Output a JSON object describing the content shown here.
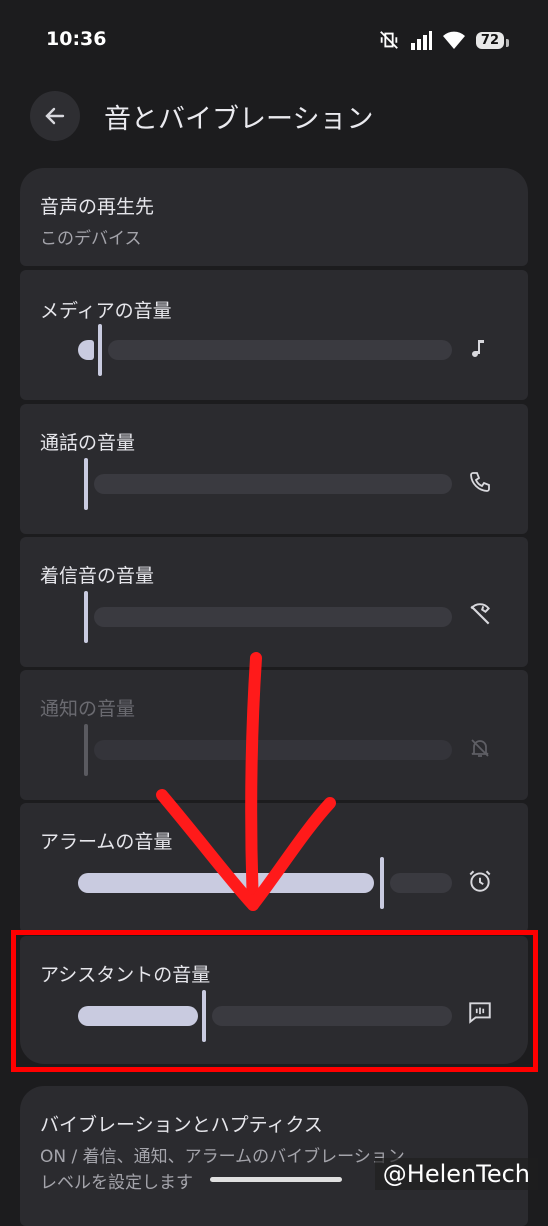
{
  "status": {
    "time": "10:36",
    "battery": "72"
  },
  "header": {
    "title": "音とバイブレーション"
  },
  "output": {
    "title": "音声の再生先",
    "value": "このデバイス"
  },
  "volumes": [
    {
      "label": "メディアの音量",
      "icon": "music-note-icon",
      "level": 0.02,
      "enabled": true
    },
    {
      "label": "通話の音量",
      "icon": "phone-icon",
      "level": 0.0,
      "enabled": true
    },
    {
      "label": "着信音の音量",
      "icon": "ringer-muted-icon",
      "level": 0.0,
      "enabled": true
    },
    {
      "label": "通知の音量",
      "icon": "notification-off-icon",
      "level": 0.0,
      "enabled": false
    },
    {
      "label": "アラームの音量",
      "icon": "alarm-icon",
      "level": 0.82,
      "enabled": true
    },
    {
      "label": "アシスタントの音量",
      "icon": "assistant-icon",
      "level": 0.34,
      "enabled": true
    }
  ],
  "vibration": {
    "title": "バイブレーションとハプティクス",
    "sub1": "ON / 着信、通知、アラームのバイブレーション",
    "sub2": "レベルを設定します"
  },
  "watermark": "@HelenTech",
  "colors": {
    "highlight": "#ff0000",
    "annotation": "#ff1a1a",
    "slider_active": "#c9cbe0"
  }
}
